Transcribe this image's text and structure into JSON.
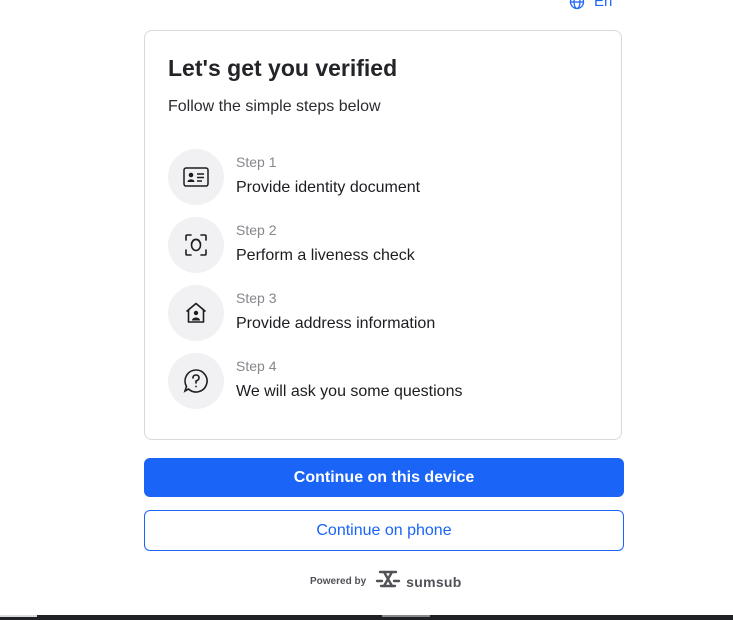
{
  "language": {
    "label": "En",
    "icon": "globe-icon"
  },
  "card": {
    "title": "Let's get you verified",
    "subtitle": "Follow the simple steps below",
    "steps": [
      {
        "label": "Step 1",
        "text": "Provide identity document",
        "icon": "id-card-icon"
      },
      {
        "label": "Step 2",
        "text": "Perform a liveness check",
        "icon": "face-scan-icon"
      },
      {
        "label": "Step 3",
        "text": "Provide address information",
        "icon": "home-person-icon"
      },
      {
        "label": "Step 4",
        "text": "We will ask you some questions",
        "icon": "question-bubble-icon"
      }
    ]
  },
  "buttons": {
    "continue_device": "Continue on this device",
    "continue_phone": "Continue on phone"
  },
  "footer": {
    "powered_by": "Powered by",
    "brand": "sumsub",
    "brand_icon": "sumsub-logo-icon"
  },
  "colors": {
    "accent": "#1a64f7",
    "icon_bg": "#f1f1f3",
    "border": "#d7d9de"
  }
}
